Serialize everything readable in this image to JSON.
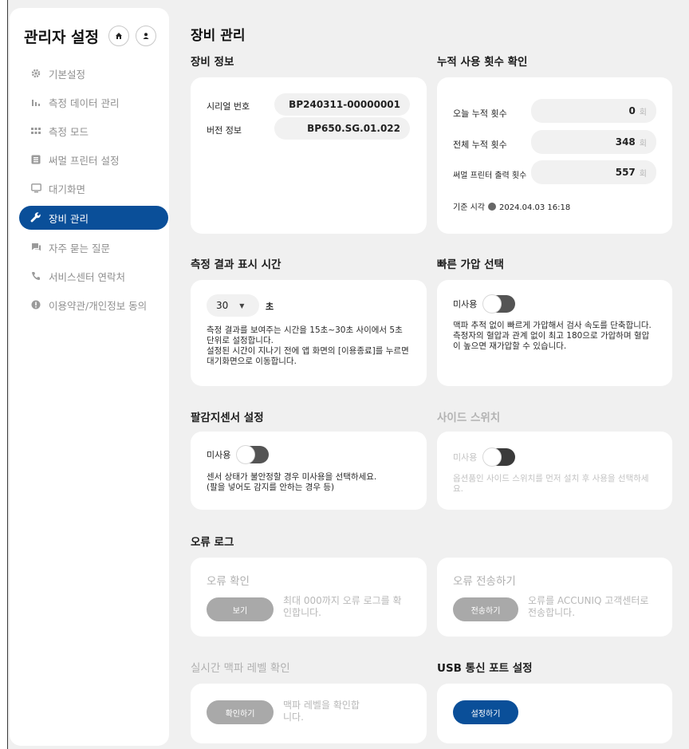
{
  "sidebar": {
    "title": "관리자 설정",
    "items": [
      {
        "label": "기본설정",
        "icon": "gear-icon",
        "active": false
      },
      {
        "label": "측정 데이터 관리",
        "icon": "bar-chart-icon",
        "active": false
      },
      {
        "label": "측정 모드",
        "icon": "grid-icon",
        "active": false
      },
      {
        "label": "써멀 프린터 설정",
        "icon": "list-icon",
        "active": false
      },
      {
        "label": "대기화면",
        "icon": "monitor-icon",
        "active": false
      },
      {
        "label": "장비 관리",
        "icon": "wrench-icon",
        "active": true
      },
      {
        "label": "자주 묻는 질문",
        "icon": "chat-icon",
        "active": false
      },
      {
        "label": "서비스센터 연락처",
        "icon": "phone-icon",
        "active": false
      },
      {
        "label": "이용약관/개인정보 동의",
        "icon": "info-icon",
        "active": false
      }
    ]
  },
  "page": {
    "title": "장비 관리"
  },
  "device_info": {
    "title": "장비 정보",
    "serial_label": "시리얼 번호",
    "serial_value": "BP240311-00000001",
    "version_label": "버전 정보",
    "version_value": "BP650.SG.01.022"
  },
  "usage": {
    "title": "누적 사용 횟수 확인",
    "today_label": "오늘 누적 횟수",
    "today_value": "0",
    "total_label": "전체 누적 횟수",
    "total_value": "348",
    "printer_label": "써멀 프린터 출력 횟수",
    "printer_value": "557",
    "unit": "회",
    "time_label": "기준 시각",
    "time_value": "2024.04.03 16:18"
  },
  "display_time": {
    "title": "측정 결과 표시 시간",
    "value": "30",
    "unit": "초",
    "desc1": "측정 결과를 보여주는 시간을 15초~30초 사이에서 5초",
    "desc2": "단위로 설정합니다.",
    "desc3": "설정된 시간이 지나기 전에 앱 화면의 [이용종료]를 누르면",
    "desc4": "대기화면으로 이동합니다."
  },
  "fast_pressure": {
    "title": "빠른 가압 선택",
    "toggle_label": "미사용",
    "desc1": "맥파 추적 없이 빠르게 가압해서 검사 속도를 단축합니다.",
    "desc2": "측정자의 혈압과 관계 없이 최고 180으로 가압하며 혈압",
    "desc3": "이 높으면 재가압할 수 있습니다."
  },
  "arm_sensor": {
    "title": "팔감지센서 설정",
    "toggle_label": "미사용",
    "desc1": "센서 상태가 불안정할 경우 미사용을 선택하세요.",
    "desc2": "(팔을 넣어도 감지를 안하는 경우 등)"
  },
  "side_switch": {
    "title": "사이드 스위치",
    "toggle_label": "미사용",
    "desc1": "옵션품인 사이드 스위치를 먼저 설치 후 사용을 선택하세",
    "desc2": "요."
  },
  "error_log": {
    "title": "오류 로그",
    "check_title": "오류 확인",
    "check_button": "보기",
    "check_desc1": "최대 000까지 오류 로그를 확",
    "check_desc2": "인합니다.",
    "send_title": "오류 전송하기",
    "send_button": "전송하기",
    "send_desc1": "오류를 ACCUNIQ 고객센터로",
    "send_desc2": "전송합니다."
  },
  "pulse_level": {
    "title": "실시간 맥파 레벨 확인",
    "button": "확인하기",
    "desc1": "맥파 레벨을 확인합",
    "desc2": "니다."
  },
  "usb_port": {
    "title": "USB 통신 포트 설정",
    "button": "설정하기"
  },
  "colors": {
    "accent": "#0a4f99",
    "background": "#f0f0f0",
    "disabled_button": "#a9a9a9"
  }
}
